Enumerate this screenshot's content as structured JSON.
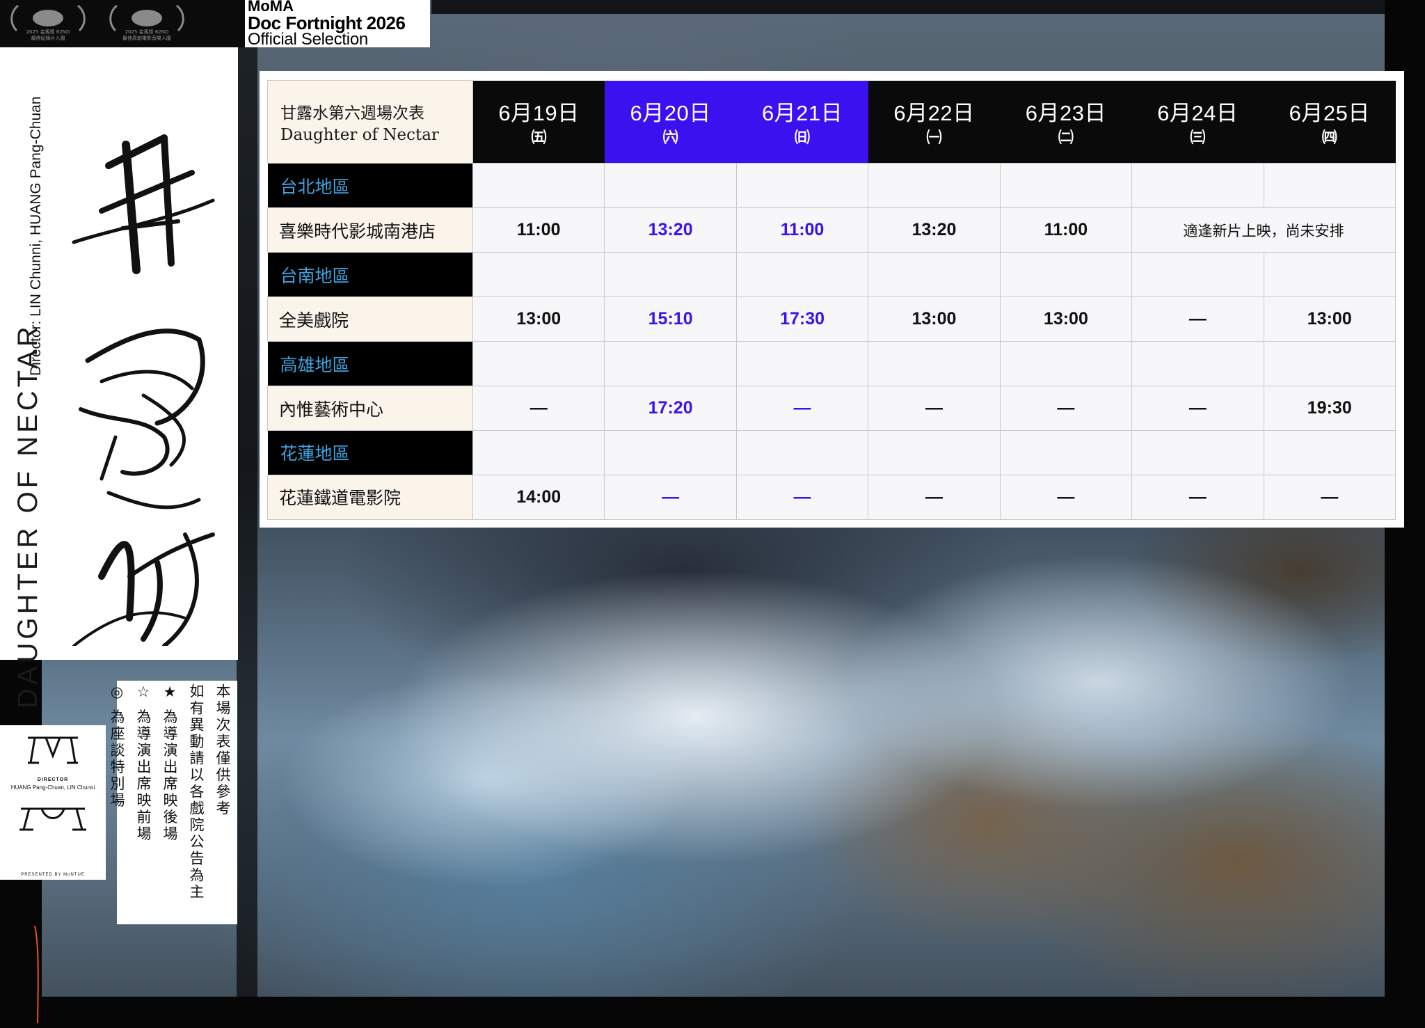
{
  "top": {
    "laurels": [
      {
        "line1": "2025 金馬獎 62ND",
        "line2": "最佳紀錄片入圍"
      },
      {
        "line1": "2025 金馬獎 62ND",
        "line2": "最佳原創電影音樂入圍"
      }
    ],
    "moma": {
      "line1": "MoMA",
      "line2": "Doc Fortnight 2026",
      "line3": "Official Selection"
    }
  },
  "poster": {
    "vertical_director": "Director: LIN Chunni, HUANG Pang-Chuan",
    "vertical_title": "DAUGHTER OF NECTAR",
    "calligraphy": "甘露水"
  },
  "credits": {
    "director_label": "DIRECTOR",
    "director_names": "HUANG Pang-Chuan,  LIN Chunni",
    "presented": "PRESENTED BY  MoNTUE"
  },
  "notes": [
    "本場次表僅供參考",
    "如有異動請以各戲院公告為主",
    "★ 為導演出席映後場",
    "☆ 為導演出席映前場",
    "◎ 為座談特別場"
  ],
  "schedule": {
    "title_zh": "甘露水第六週場次表",
    "title_en": "Daughter of Nectar",
    "days": [
      {
        "date": "6月19日",
        "weekday": "㈤",
        "highlight": false
      },
      {
        "date": "6月20日",
        "weekday": "㈥",
        "highlight": true
      },
      {
        "date": "6月21日",
        "weekday": "㈰",
        "highlight": true
      },
      {
        "date": "6月22日",
        "weekday": "㈠",
        "highlight": false
      },
      {
        "date": "6月23日",
        "weekday": "㈡",
        "highlight": false
      },
      {
        "date": "6月24日",
        "weekday": "㈢",
        "highlight": false
      },
      {
        "date": "6月25日",
        "weekday": "㈣",
        "highlight": false
      }
    ],
    "regions": [
      {
        "name": "台北地區",
        "theater": "喜樂時代影城南港店",
        "times": [
          "11:00",
          "13:20",
          "11:00",
          "13:20",
          "11:00",
          "適逢新片上映，尚未安排"
        ]
      },
      {
        "name": "台南地區",
        "theater": "全美戲院",
        "times": [
          "13:00",
          "15:10",
          "17:30",
          "13:00",
          "13:00",
          "—",
          "13:00"
        ]
      },
      {
        "name": "高雄地區",
        "theater": "內惟藝術中心",
        "times": [
          "—",
          "17:20",
          "—",
          "—",
          "—",
          "—",
          "19:30"
        ]
      },
      {
        "name": "花蓮地區",
        "theater": "花蓮鐵道電影院",
        "times": [
          "14:00",
          "—",
          "—",
          "—",
          "—",
          "—",
          "—"
        ]
      }
    ]
  },
  "colors": {
    "weekend_blue": "#3b12ef",
    "region_text": "#3ea3e0",
    "header_black": "#0a0a0a",
    "theater_bg": "#faf4ea"
  }
}
